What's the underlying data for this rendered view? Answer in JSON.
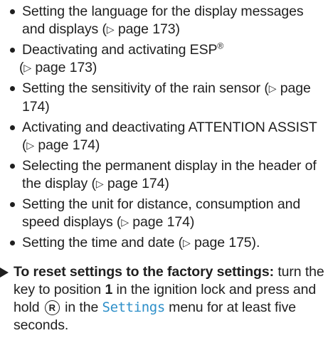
{
  "bullets": [
    {
      "text": "Setting the language for the display messages and displays (",
      "ref": "▷",
      "page": " page 173)"
    },
    {
      "text": "Deactivating and activating ESP",
      "sup": "®",
      "text2": " (",
      "ref": "▷",
      "page": " page 173)"
    },
    {
      "text": "Setting the sensitivity of the rain sensor (",
      "ref": "▷",
      "page": " page 174)"
    },
    {
      "text": "Activating and deactivating ATTENTION ASSIST (",
      "ref": "▷",
      "page": " page 174)"
    },
    {
      "text": "Selecting the permanent display in the header of the display (",
      "ref": "▷",
      "page": " page 174)"
    },
    {
      "text": "Setting the unit for distance, consumption and speed displays (",
      "ref": "▷",
      "page": " page 174)"
    },
    {
      "text": "Setting the time and date (",
      "ref": "▷",
      "page": " page 175)."
    }
  ],
  "instruction": {
    "heading": "To reset settings to the factory settings:",
    "part1": " turn the key to position ",
    "position": "1",
    "part2": " in the ignition lock and press and hold ",
    "key_symbol": "R",
    "part3": " in the ",
    "menu": "Settings",
    "part4": " menu for at least five seconds."
  }
}
